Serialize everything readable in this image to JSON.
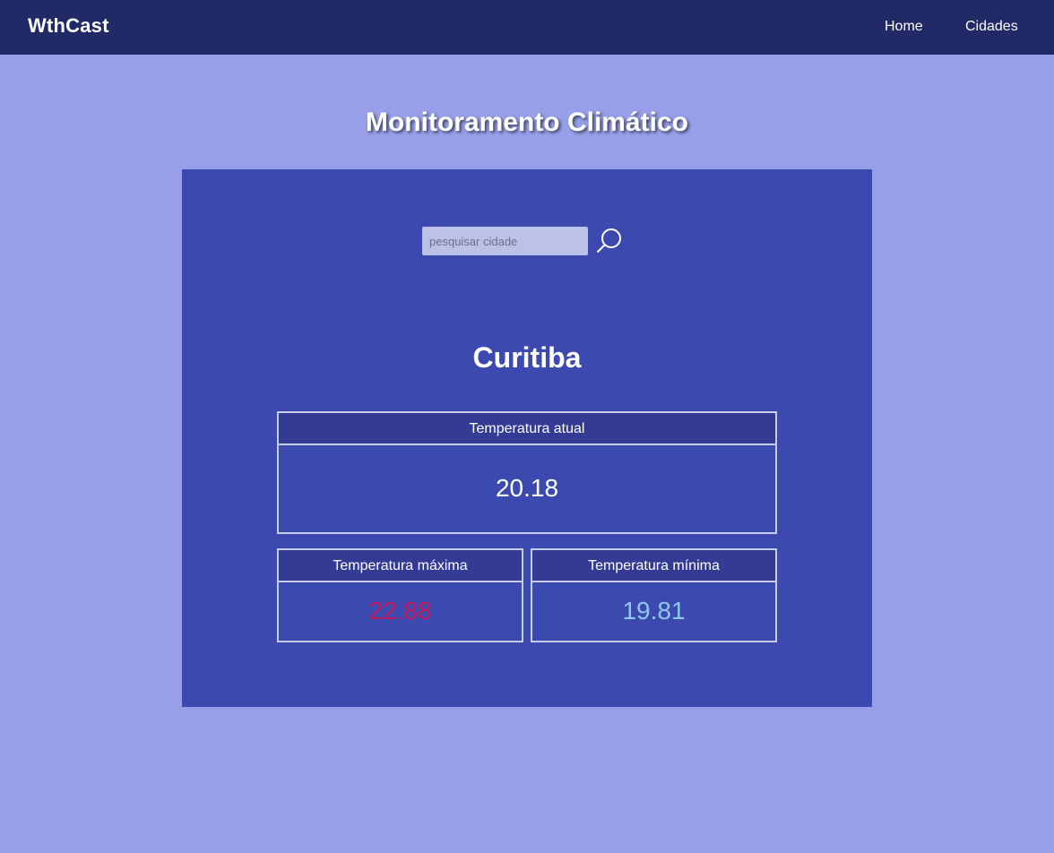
{
  "navbar": {
    "brand": "WthCast",
    "links": [
      {
        "label": "Home"
      },
      {
        "label": "Cidades"
      }
    ]
  },
  "main": {
    "title": "Monitoramento Climático"
  },
  "search": {
    "placeholder": "pesquisar cidade",
    "value": "",
    "icon": "search-icon"
  },
  "weather": {
    "city": "Curitiba",
    "current": {
      "label": "Temperatura atual",
      "value": "20.18"
    },
    "max": {
      "label": "Temperatura máxima",
      "value": "22.88"
    },
    "min": {
      "label": "Temperatura mínima",
      "value": "19.81"
    }
  },
  "colors": {
    "page_background": "#969fe8",
    "navbar": "#212966",
    "panel": "#3c4aaf",
    "card_header": "#333b94",
    "max_temperature": "#c2185b",
    "min_temperature": "#8ec8ec"
  }
}
